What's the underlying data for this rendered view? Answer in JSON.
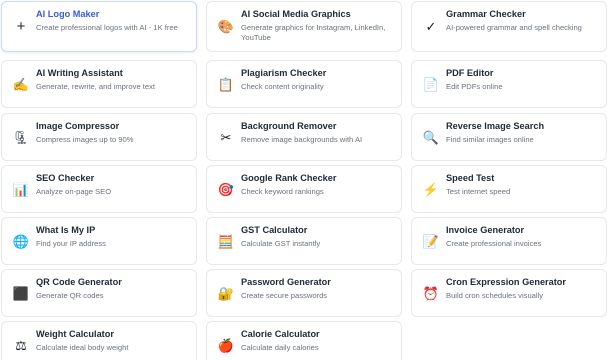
{
  "tools": [
    {
      "id": "ai-logo-maker",
      "title": "AI Logo Maker",
      "desc": "Create professional logos with AI - 1K free",
      "icon": "plus-icon",
      "glyph": "+"
    },
    {
      "id": "ai-social-media-graphics",
      "title": "AI Social Media Graphics",
      "desc": "Generate graphics for Instagram, LinkedIn, YouTube",
      "icon": "palette-icon",
      "glyph": "🎨"
    },
    {
      "id": "grammar-checker",
      "title": "Grammar Checker",
      "desc": "AI-powered grammar and spell checking",
      "icon": "checkmark-icon",
      "glyph": "✓"
    },
    {
      "id": "ai-writing-assistant",
      "title": "AI Writing Assistant",
      "desc": "Generate, rewrite, and improve text",
      "icon": "writing-hand-icon",
      "glyph": "✍"
    },
    {
      "id": "plagiarism-checker",
      "title": "Plagiarism Checker",
      "desc": "Check content originality",
      "icon": "clipboard-icon",
      "glyph": "📋"
    },
    {
      "id": "pdf-editor",
      "title": "PDF Editor",
      "desc": "Edit PDFs online",
      "icon": "document-icon",
      "glyph": "📄"
    },
    {
      "id": "image-compressor",
      "title": "Image Compressor",
      "desc": "Compress images up to 90%",
      "icon": "compress-icon",
      "glyph": "🗜"
    },
    {
      "id": "background-remover",
      "title": "Background Remover",
      "desc": "Remove image backgrounds with AI",
      "icon": "scissors-icon",
      "glyph": "✂"
    },
    {
      "id": "reverse-image-search",
      "title": "Reverse Image Search",
      "desc": "Find similar images online",
      "icon": "magnifier-icon",
      "glyph": "🔍"
    },
    {
      "id": "seo-checker",
      "title": "SEO Checker",
      "desc": "Analyze on-page SEO",
      "icon": "bar-chart-icon",
      "glyph": "📊"
    },
    {
      "id": "google-rank-checker",
      "title": "Google Rank Checker",
      "desc": "Check keyword rankings",
      "icon": "target-icon",
      "glyph": "🎯"
    },
    {
      "id": "speed-test",
      "title": "Speed Test",
      "desc": "Test internet speed",
      "icon": "lightning-icon",
      "glyph": "⚡"
    },
    {
      "id": "what-is-my-ip",
      "title": "What Is My IP",
      "desc": "Find your IP address",
      "icon": "globe-icon",
      "glyph": "🌐"
    },
    {
      "id": "gst-calculator",
      "title": "GST Calculator",
      "desc": "Calculate GST instantly",
      "icon": "abacus-icon",
      "glyph": "🧮"
    },
    {
      "id": "invoice-generator",
      "title": "Invoice Generator",
      "desc": "Create professional invoices",
      "icon": "invoice-icon",
      "glyph": "📝"
    },
    {
      "id": "qr-code-generator",
      "title": "QR Code Generator",
      "desc": "Generate QR codes",
      "icon": "qr-square-icon",
      "glyph": "⬛"
    },
    {
      "id": "password-generator",
      "title": "Password Generator",
      "desc": "Create secure passwords",
      "icon": "lock-icon",
      "glyph": "🔐"
    },
    {
      "id": "cron-expression-generator",
      "title": "Cron Expression Generator",
      "desc": "Build cron schedules visually",
      "icon": "alarm-clock-icon",
      "glyph": "⏰"
    },
    {
      "id": "weight-calculator",
      "title": "Weight Calculator",
      "desc": "Calculate ideal body weight",
      "icon": "scales-icon",
      "glyph": "⚖"
    },
    {
      "id": "calorie-calculator",
      "title": "Calorie Calculator",
      "desc": "Calculate daily calories",
      "icon": "apple-icon",
      "glyph": "🍎"
    }
  ],
  "colors": {
    "active_title": "#3b5bdb",
    "title": "#1f2937",
    "description": "#6b7280",
    "card_border": "#e6e8ec"
  }
}
